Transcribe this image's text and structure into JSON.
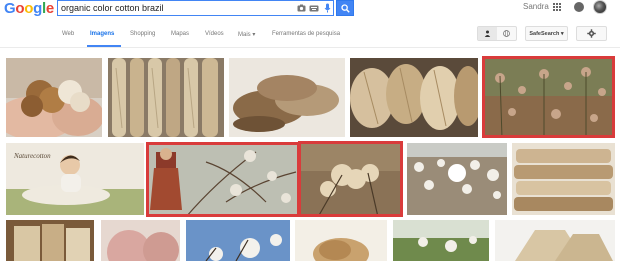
{
  "header": {
    "logo_letters": [
      {
        "ch": "G",
        "color": "#4285f4"
      },
      {
        "ch": "o",
        "color": "#ea4335"
      },
      {
        "ch": "o",
        "color": "#fbbc05"
      },
      {
        "ch": "g",
        "color": "#4285f4"
      },
      {
        "ch": "l",
        "color": "#34a853"
      },
      {
        "ch": "e",
        "color": "#ea4335"
      }
    ],
    "search_value": "organic color cotton brazil",
    "user_name": "Sandra"
  },
  "nav": {
    "tabs": [
      "Web",
      "Imagens",
      "Shopping",
      "Mapas",
      "Vídeos",
      "Mais ▾",
      "Ferramentas de pesquisa"
    ],
    "active_tab": "Imagens",
    "safesearch_label": "SafeSearch ▾"
  },
  "results": {
    "images": [
      {
        "subject": "hands holding brown cotton bolls",
        "selected": false
      },
      {
        "subject": "hanging beige cotton yarn skeins",
        "selected": false
      },
      {
        "subject": "brown yarn skeins",
        "selected": false
      },
      {
        "subject": "beige yarn skeins",
        "selected": false
      },
      {
        "subject": "brown cotton plants in field",
        "selected": true
      },
      {
        "subject": "baby on cotton",
        "watermark": "Naturecotton",
        "selected": false
      },
      {
        "subject": "fashion model among cotton branches",
        "selected": true
      },
      {
        "subject": "colored cotton bolls on plant",
        "selected": true
      },
      {
        "subject": "white cotton field",
        "selected": false
      },
      {
        "subject": "folded beige towels",
        "selected": false
      },
      {
        "subject": "cotton bundles",
        "selected": false
      },
      {
        "subject": "pink yarn balls",
        "selected": false
      },
      {
        "subject": "cotton bolls against sky",
        "selected": false
      },
      {
        "subject": "raw colored cotton",
        "selected": false
      },
      {
        "subject": "cotton plant green field",
        "selected": false
      },
      {
        "subject": "cream yarn cones",
        "selected": false
      }
    ]
  },
  "colors": {
    "accent": "#4285f4",
    "selection": "#d93b3b"
  }
}
